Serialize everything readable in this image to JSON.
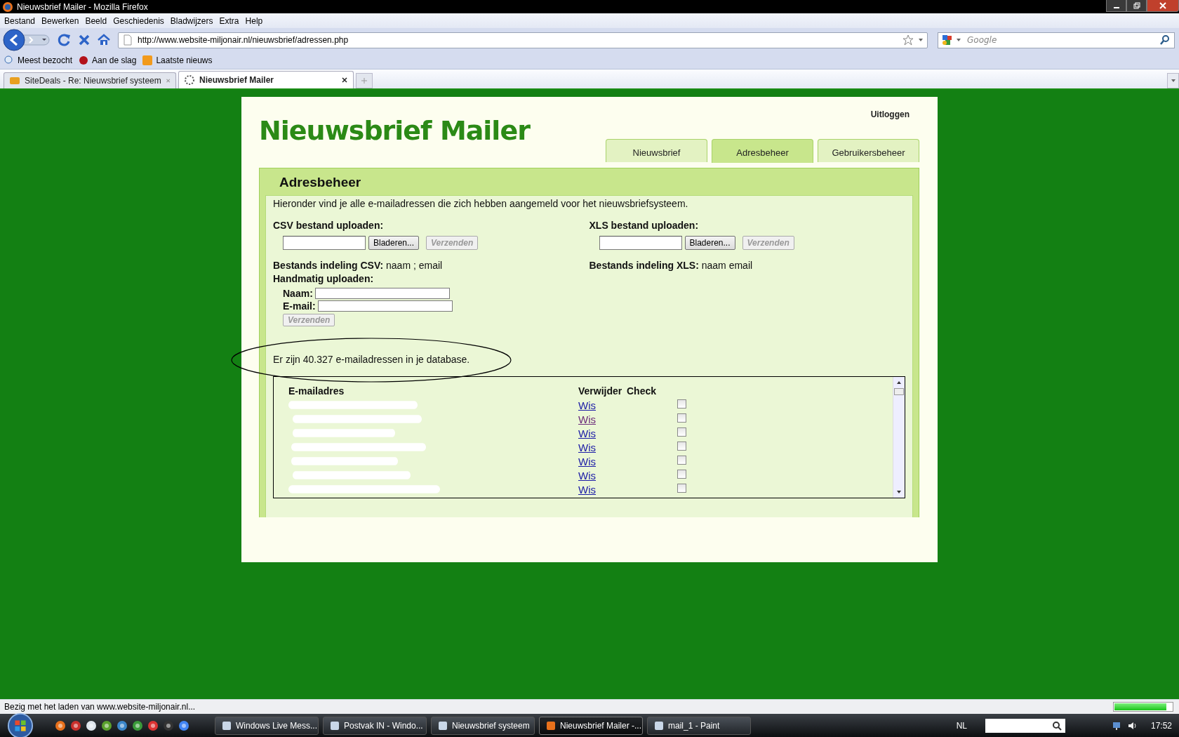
{
  "window": {
    "title": "Nieuwsbrief Mailer - Mozilla Firefox"
  },
  "menu": [
    "Bestand",
    "Bewerken",
    "Beeld",
    "Geschiedenis",
    "Bladwijzers",
    "Extra",
    "Help"
  ],
  "address": {
    "value": "http://www.website-miljonair.nl/nieuwsbrief/adressen.php"
  },
  "search": {
    "placeholder": "Google"
  },
  "bookmarks": [
    "Meest bezocht",
    "Aan de slag",
    "Laatste nieuws"
  ],
  "tabs": [
    {
      "label": "SiteDeals - Re: Nieuwsbrief systeem",
      "selected": false
    },
    {
      "label": "Nieuwsbrief Mailer",
      "selected": true
    }
  ],
  "page": {
    "logout": "Uitloggen",
    "title": "Nieuwsbrief Mailer",
    "nav": [
      {
        "label": "Nieuwsbrief",
        "selected": false
      },
      {
        "label": "Adresbeheer",
        "selected": true
      },
      {
        "label": "Gebruikersbeheer",
        "selected": false
      }
    ],
    "heading": "Adresbeheer",
    "intro": "Hieronder vind je alle e-mailadressen die zich hebben aangemeld voor het nieuwsbriefsysteem.",
    "uploads": [
      {
        "heading": "CSV bestand uploaden:",
        "browse": "Bladeren...",
        "submit": "Verzenden",
        "disabled": true,
        "format_label": "Bestands indeling CSV:",
        "format": "naam ; email"
      },
      {
        "heading": "XLS bestand uploaden:",
        "browse": "Bladeren...",
        "submit": "Verzenden",
        "disabled": true,
        "format_label": "Bestands indeling XLS:",
        "format": "naam email"
      }
    ],
    "manual": {
      "heading": "Handmatig uploaden:",
      "fields": [
        {
          "label": "Naam:"
        },
        {
          "label": "E-mail:"
        }
      ],
      "submit": "Verzenden",
      "disabled": true
    },
    "count": "Er zijn 40.327 e-mailadressen in je database.",
    "table": {
      "columns": [
        "E-mailadres",
        "Verwijder",
        "Check"
      ],
      "rows": [
        {
          "action": "Wis",
          "visited": false,
          "checked": false
        },
        {
          "action": "Wis",
          "visited": true,
          "checked": false
        },
        {
          "action": "Wis",
          "visited": false,
          "checked": false
        },
        {
          "action": "Wis",
          "visited": false,
          "checked": false
        },
        {
          "action": "Wis",
          "visited": false,
          "checked": false
        },
        {
          "action": "Wis",
          "visited": false,
          "checked": false
        },
        {
          "action": "Wis",
          "visited": false,
          "checked": false
        }
      ]
    }
  },
  "status_bar": {
    "text": "Bezig met het laden van www.website-miljonair.nl...",
    "level": 0.9
  },
  "taskbar": {
    "tasks": [
      {
        "label": "Windows Live Mess...",
        "selected": false
      },
      {
        "label": "Postvak IN - Windo...",
        "selected": false
      },
      {
        "label": "Nieuwsbrief systeem",
        "selected": false
      },
      {
        "label": "Nieuwsbrief Mailer -...",
        "selected": true
      },
      {
        "label": "mail_1 - Paint",
        "selected": false
      }
    ],
    "language": "NL",
    "clock": "17:52"
  }
}
